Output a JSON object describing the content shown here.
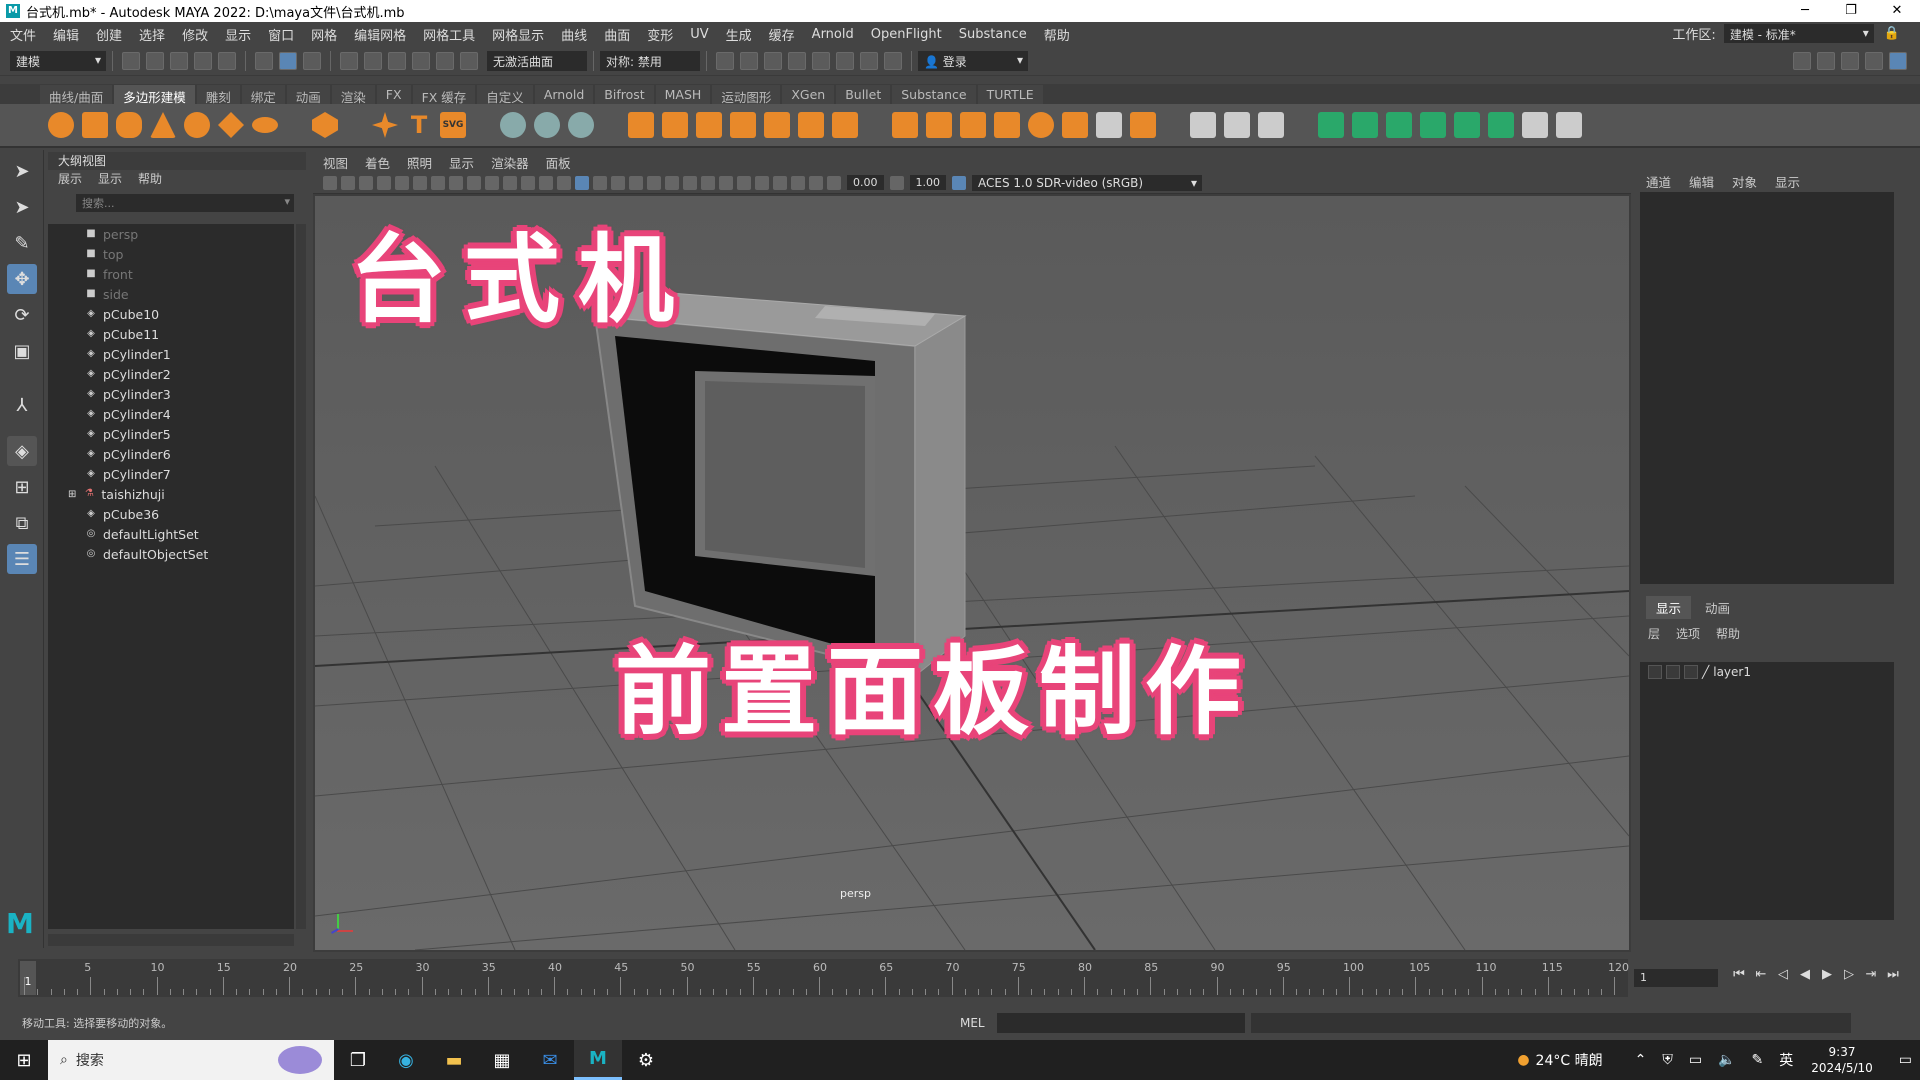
{
  "window": {
    "title": "台式机.mb* - Autodesk MAYA 2022: D:\\maya文件\\台式机.mb",
    "minimize": "─",
    "maximize": "❐",
    "close": "✕"
  },
  "menubar": {
    "items": [
      "文件",
      "编辑",
      "创建",
      "选择",
      "修改",
      "显示",
      "窗口",
      "网格",
      "编辑网格",
      "网格工具",
      "网格显示",
      "曲线",
      "曲面",
      "变形",
      "UV",
      "生成",
      "缓存",
      "Arnold",
      "OpenFlight",
      "Substance",
      "帮助"
    ],
    "workspace_label": "工作区:",
    "workspace_value": "建模 - 标准*"
  },
  "statusline": {
    "mode": "建模",
    "live_surface": "无激活曲面",
    "symmetry": "对称: 禁用",
    "login": "登录"
  },
  "shelf": {
    "tabs": [
      "曲线/曲面",
      "多边形建模",
      "雕刻",
      "绑定",
      "动画",
      "渲染",
      "FX",
      "FX 缓存",
      "自定义",
      "Arnold",
      "Bifrost",
      "MASH",
      "运动图形",
      "XGen",
      "Bullet",
      "Substance",
      "TURTLE"
    ],
    "active_tab": "多边形建模",
    "icon_color": "#e8892a",
    "svg_label": "SVG"
  },
  "outliner": {
    "title": "大纲视图",
    "menu": [
      "展示",
      "显示",
      "帮助"
    ],
    "search_placeholder": "搜索...",
    "items": [
      {
        "label": "persp",
        "icon": "camera-icon",
        "dim": true
      },
      {
        "label": "top",
        "icon": "camera-icon",
        "dim": true
      },
      {
        "label": "front",
        "icon": "camera-icon",
        "dim": true
      },
      {
        "label": "side",
        "icon": "camera-icon",
        "dim": true
      },
      {
        "label": "pCube10",
        "icon": "mesh-icon",
        "dim": false
      },
      {
        "label": "pCube11",
        "icon": "mesh-icon",
        "dim": false
      },
      {
        "label": "pCylinder1",
        "icon": "mesh-icon",
        "dim": false
      },
      {
        "label": "pCylinder2",
        "icon": "mesh-icon",
        "dim": false
      },
      {
        "label": "pCylinder3",
        "icon": "mesh-icon",
        "dim": false
      },
      {
        "label": "pCylinder4",
        "icon": "mesh-icon",
        "dim": false
      },
      {
        "label": "pCylinder5",
        "icon": "mesh-icon",
        "dim": false
      },
      {
        "label": "pCylinder6",
        "icon": "mesh-icon",
        "dim": false
      },
      {
        "label": "pCylinder7",
        "icon": "mesh-icon",
        "dim": false
      },
      {
        "label": "taishizhuji",
        "icon": "group-icon",
        "dim": false
      },
      {
        "label": "pCube36",
        "icon": "mesh-icon",
        "dim": false
      },
      {
        "label": "defaultLightSet",
        "icon": "set-icon",
        "dim": false
      },
      {
        "label": "defaultObjectSet",
        "icon": "set-icon",
        "dim": false
      }
    ]
  },
  "viewport": {
    "menu": [
      "视图",
      "着色",
      "照明",
      "显示",
      "渲染器",
      "面板"
    ],
    "value_a": "0.00",
    "value_b": "1.00",
    "colorspace": "ACES 1.0 SDR-video (sRGB)",
    "camera": "persp",
    "overlay_title_top": "台式机",
    "overlay_title_bottom": "前置面板制作",
    "overlay_stroke_color": "#e8457a"
  },
  "channelbox": {
    "menu": [
      "通道",
      "编辑",
      "对象",
      "显示"
    ],
    "tabs": [
      "显示",
      "动画"
    ],
    "layer_menu": [
      "层",
      "选项",
      "帮助"
    ],
    "layers": [
      {
        "name": "layer1"
      }
    ]
  },
  "timeslider": {
    "current_frame": "1",
    "frame_field": "1",
    "ticks": [
      "5",
      "10",
      "15",
      "20",
      "25",
      "30",
      "35",
      "40",
      "45",
      "50",
      "55",
      "60",
      "65",
      "70",
      "75",
      "80",
      "85",
      "90",
      "95",
      "100",
      "105",
      "110",
      "115",
      "120"
    ]
  },
  "cmdline": {
    "help_text": "移动工具: 选择要移动的对象。",
    "lang": "MEL"
  },
  "taskbar": {
    "search": "搜索",
    "weather": "24°C 晴朗",
    "ime": "英",
    "time": "9:37",
    "date": "2024/5/10"
  }
}
